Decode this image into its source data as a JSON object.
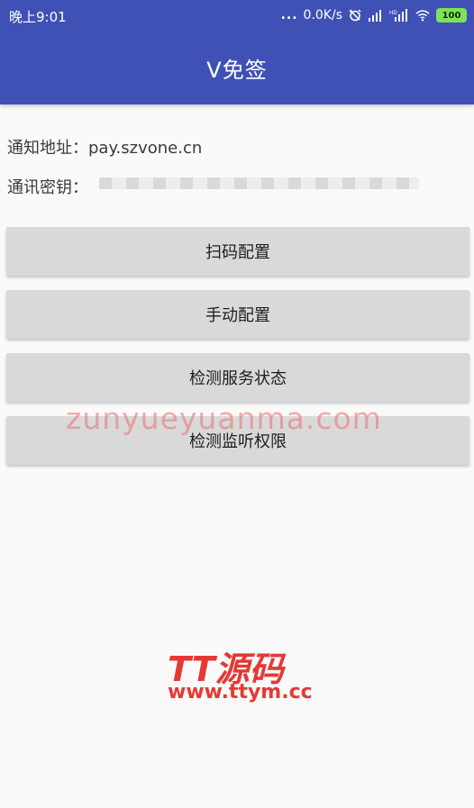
{
  "status_bar": {
    "time": "晚上9:01",
    "more_dots": "...",
    "network_speed": "0.0K/s",
    "alarm_icon": "alarm-off-icon",
    "signal_icon": "signal-icon",
    "hd_signal_icon": "hd-signal-icon",
    "wifi_icon": "wifi-icon",
    "battery_level": "100"
  },
  "app_bar": {
    "title": "V免签"
  },
  "info": {
    "notify_label": "通知地址：",
    "notify_value": "pay.szvone.cn",
    "secret_label": "通讯密钥："
  },
  "actions": [
    {
      "label": "扫码配置"
    },
    {
      "label": "手动配置"
    },
    {
      "label": "检测服务状态"
    },
    {
      "label": "检测监听权限"
    }
  ],
  "watermarks": {
    "site_text": "zunyueyuanma.com",
    "logo_text": "TT源码",
    "logo_url": "www.ttym.cc"
  },
  "colors": {
    "primary": "#3f51b5",
    "background": "#fafafa",
    "button": "#d9d9d9",
    "watermark": "#e53935"
  }
}
